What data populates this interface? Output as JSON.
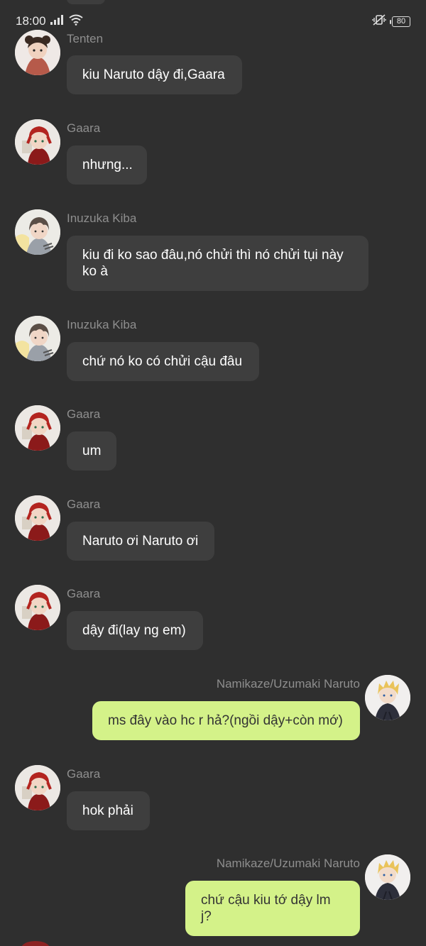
{
  "status_bar": {
    "time": "18:00",
    "battery": "80"
  },
  "messages": [
    {
      "side": "left",
      "avatar": "tenten",
      "sender": "Tenten",
      "text": "kiu Naruto dậy đi,Gaara"
    },
    {
      "side": "left",
      "avatar": "gaara",
      "sender": "Gaara",
      "text": "nhưng..."
    },
    {
      "side": "left",
      "avatar": "kiba",
      "sender": "Inuzuka Kiba",
      "text": "kiu đi ko sao đâu,nó chửi thì nó chửi tụi này ko à"
    },
    {
      "side": "left",
      "avatar": "kiba",
      "sender": "Inuzuka Kiba",
      "text": "chứ nó ko có chửi cậu đâu"
    },
    {
      "side": "left",
      "avatar": "gaara",
      "sender": "Gaara",
      "text": "um"
    },
    {
      "side": "left",
      "avatar": "gaara",
      "sender": "Gaara",
      "text": "Naruto ơi Naruto ơi"
    },
    {
      "side": "left",
      "avatar": "gaara",
      "sender": "Gaara",
      "text": "dậy đi(lay ng em)"
    },
    {
      "side": "right",
      "avatar": "naruto",
      "sender": "Namikaze/Uzumaki Naruto",
      "text": "ms đây vào hc r hả?(ngồi dậy+còn mớ)"
    },
    {
      "side": "left",
      "avatar": "gaara",
      "sender": "Gaara",
      "text": "hok phải"
    },
    {
      "side": "right",
      "avatar": "naruto",
      "sender": "Namikaze/Uzumaki Naruto",
      "text": "chứ cậu kiu tớ dậy lm j?"
    }
  ],
  "colors": {
    "background": "#2f2f2f",
    "bubble_other": "#3e3e3e",
    "bubble_mine": "#d4f289",
    "sender_name": "#8e8e8e"
  }
}
